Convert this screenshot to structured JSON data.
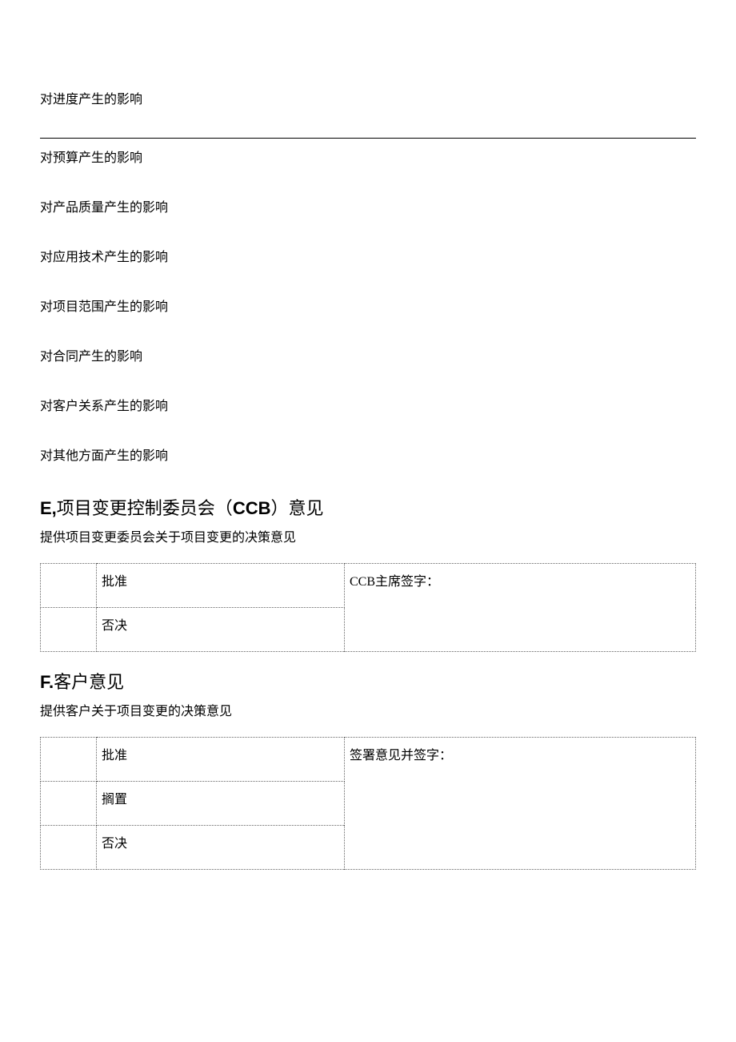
{
  "impacts": {
    "schedule": "对进度产生的影响",
    "budget": "对预算产生的影响",
    "quality": "对产品质量产生的影响",
    "technology": "对应用技术产生的影响",
    "scope": "对项目范围产生的影响",
    "contract": "对合同产生的影响",
    "customer_relation": "对客户关系产生的影响",
    "other": "对其他方面产生的影响"
  },
  "section_e": {
    "prefix": "E,",
    "title_part1": "项目变更控制委员会（",
    "ccb": "CCB",
    "title_part2": "）意见",
    "subtext": "提供项目变更委员会关于项目变更的决策意见",
    "approve": "批准",
    "reject": "否决",
    "sign_label": "CCB主席签字："
  },
  "section_f": {
    "prefix": "F.",
    "title": "客户意见",
    "subtext": "提供客户关于项目变更的决策意见",
    "approve": "批准",
    "hold": "搁置",
    "reject": "否决",
    "sign_label": "签署意见并签字："
  }
}
